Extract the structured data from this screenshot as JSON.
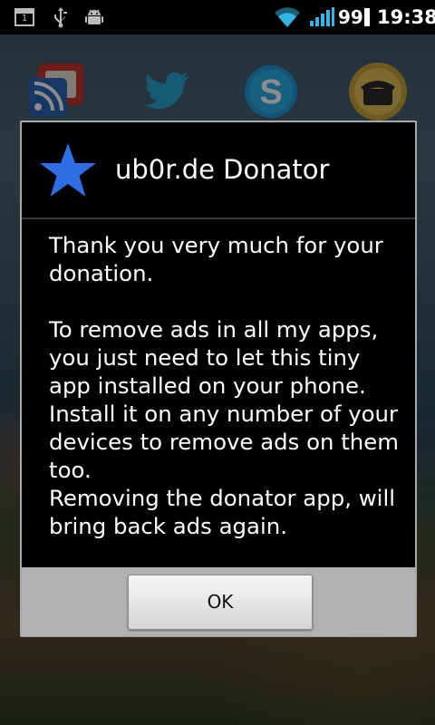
{
  "status_bar": {
    "notification_count": "1",
    "battery_percent": "99",
    "time": "19:38",
    "icons": [
      "notification-box-icon",
      "usb-icon",
      "android-debug-icon",
      "wifi-icon",
      "signal-icon"
    ]
  },
  "home_icons": [
    "google-reader-icon",
    "twitter-icon",
    "skype-icon",
    "phone-gold-icon"
  ],
  "dialog": {
    "icon": "star-icon",
    "title": "ub0r.de Donator",
    "message": "Thank you very much for your donation.\n\nTo remove ads in all my apps, you just need to let this tiny app installed on your phone.\nInstall it on any number of your devices to remove ads on them too.\nRemoving the donator app, will bring back ads again.",
    "ok_label": "OK"
  },
  "colors": {
    "star": "#2f6fe6",
    "dialog_bg": "#000000",
    "button_bar": "#b1b1b1",
    "wifi_signal": "#33b5e5"
  }
}
